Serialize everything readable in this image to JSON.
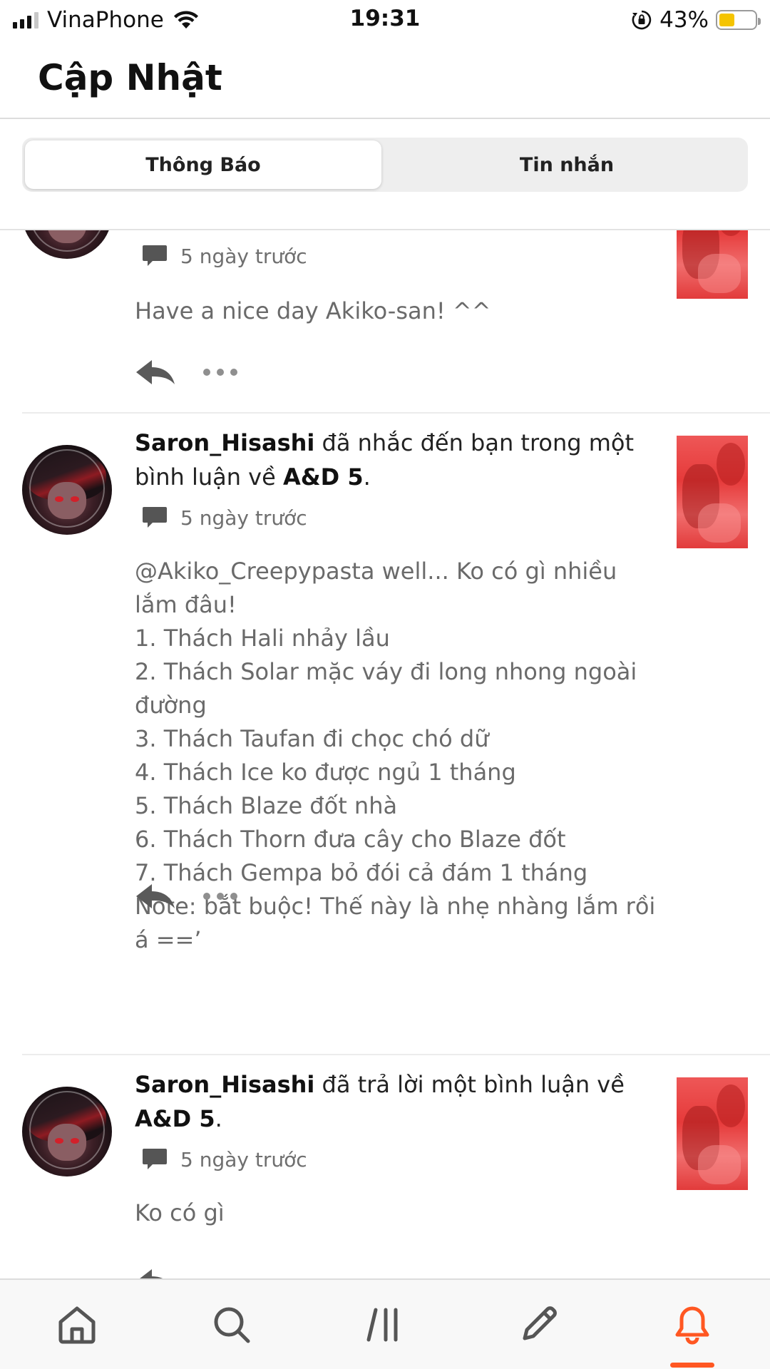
{
  "status_bar": {
    "carrier": "VinaPhone",
    "time": "19:31",
    "battery_percent": "43%",
    "battery_level": 0.43,
    "signal_bars": 3,
    "icons": [
      "signal-icon",
      "wifi-icon",
      "orientation-lock-icon",
      "battery-icon"
    ]
  },
  "header": {
    "title": "Cập Nhật"
  },
  "tabs": [
    {
      "label": "Thông Báo",
      "active": true
    },
    {
      "label": "Tin nhắn",
      "active": false
    }
  ],
  "notifications": [
    {
      "time": "5 ngày trước",
      "body": "Have a nice day Akiko-san! ^^"
    },
    {
      "user": "Saron_Hisashi",
      "action": " đã nhắc đến bạn trong một bình luận về ",
      "story": "A&D 5",
      "end": ".",
      "time": "5 ngày trước",
      "body": "@Akiko_Creepypasta well... Ko có gì nhiều lắm đâu!\n1. Thách Hali nhảy lầu\n2. Thách Solar mặc váy đi long nhong ngoài đường\n3. Thách Taufan đi chọc chó dữ\n4. Thách Ice ko được ngủ 1 tháng\n5. Thách Blaze đốt nhà\n6. Thách Thorn đưa cây cho Blaze đốt\n7. Thách Gempa bỏ đói cả đám 1 tháng\nNote: bắt buộc! Thế này là nhẹ nhàng lắm rồi á ==’"
    },
    {
      "user": "Saron_Hisashi",
      "action": " đã trả lời một bình luận về ",
      "story": "A&D 5",
      "end": ".",
      "time": "5 ngày trước",
      "body": "Ko có gì"
    }
  ],
  "bottom_nav": [
    {
      "icon": "home-icon",
      "active": false
    },
    {
      "icon": "search-icon",
      "active": false
    },
    {
      "icon": "library-icon",
      "active": false
    },
    {
      "icon": "write-icon",
      "active": false
    },
    {
      "icon": "notifications-icon",
      "active": true
    }
  ],
  "colors": {
    "accent": "#ff5722",
    "text_primary": "#222222",
    "text_secondary": "#6a6a6a",
    "divider": "#ececec"
  }
}
